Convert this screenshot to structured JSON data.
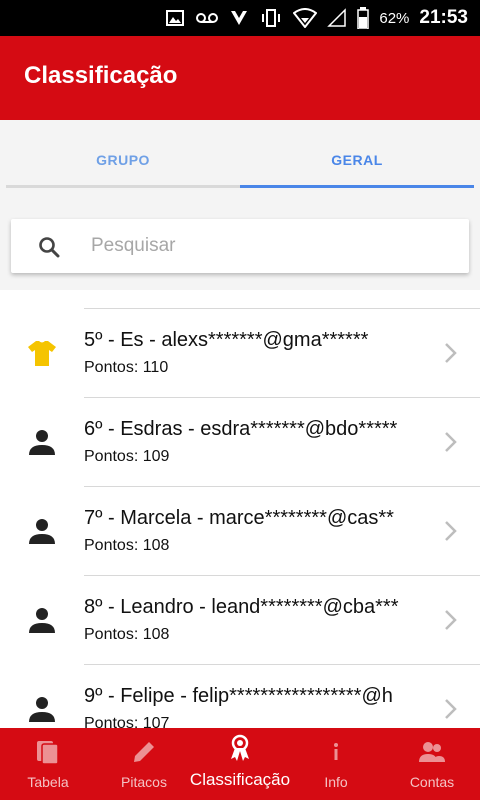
{
  "status_bar": {
    "battery": "62%",
    "time": "21:53"
  },
  "app_bar": {
    "title": "Classificação"
  },
  "tabs": [
    {
      "label": "GRUPO",
      "active": false
    },
    {
      "label": "GERAL",
      "active": true
    }
  ],
  "search": {
    "placeholder": "Pesquisar"
  },
  "ranking": [
    {
      "title": "5º - Es - alexs*******@gma******",
      "points_label": "Pontos:",
      "points": "110",
      "icon": "shirt-icon"
    },
    {
      "title": "6º - Esdras - esdra*******@bdo*****",
      "points_label": "Pontos:",
      "points": "109",
      "icon": "person-icon"
    },
    {
      "title": "7º - Marcela - marce********@cas**",
      "points_label": "Pontos:",
      "points": "108",
      "icon": "person-icon"
    },
    {
      "title": "8º - Leandro - leand********@cba***",
      "points_label": "Pontos:",
      "points": "108",
      "icon": "person-icon"
    },
    {
      "title": "9º - Felipe - felip*****************@h",
      "points_label": "Pontos:",
      "points": "107",
      "icon": "person-icon"
    }
  ],
  "bottom_nav": [
    {
      "label": "Tabela",
      "icon": "cards-icon",
      "active": false
    },
    {
      "label": "Pitacos",
      "icon": "pencil-icon",
      "active": false
    },
    {
      "label": "Classificação",
      "icon": "ribbon-icon",
      "active": true
    },
    {
      "label": "Info",
      "icon": "info-icon",
      "active": false
    },
    {
      "label": "Contas",
      "icon": "accounts-icon",
      "active": false
    }
  ],
  "colors": {
    "primary": "#d50b13",
    "tab_accent": "#4a86e8",
    "shirt": "#f5c400"
  }
}
